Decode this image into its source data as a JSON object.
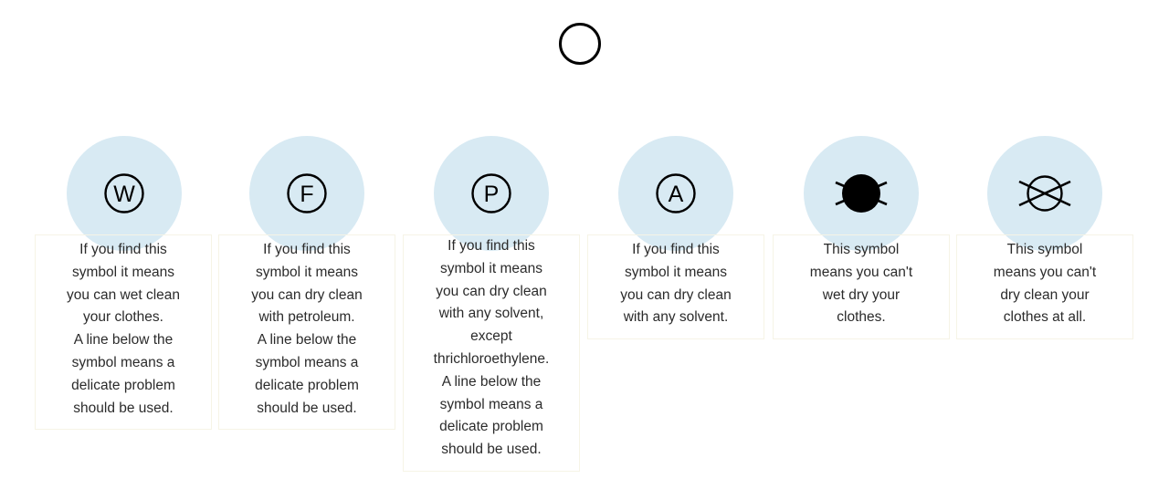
{
  "header_icon": "plain-circle-icon",
  "cards": [
    {
      "icon": "circle-w-icon",
      "letter": "W",
      "text": "If you find this\nsymbol it means\nyou can wet clean\nyour clothes.\nA line below the\nsymbol means a\ndelicate problem\nshould be used."
    },
    {
      "icon": "circle-f-icon",
      "letter": "F",
      "text": "If you find this\nsymbol it means\nyou can dry clean\nwith petroleum.\nA line below the\nsymbol means a\ndelicate problem\nshould be used."
    },
    {
      "icon": "circle-p-icon",
      "letter": "P",
      "text": "If you find this\nsymbol it means\nyou can dry clean\nwith any solvent,\nexcept\nthrichloroethylene.\nA line below the\nsymbol means a\ndelicate problem\nshould be used."
    },
    {
      "icon": "circle-a-icon",
      "letter": "A",
      "text": "If you find this\nsymbol it means\nyou can dry clean\nwith any solvent."
    },
    {
      "icon": "filled-circle-crossed-icon",
      "letter": "",
      "text": "This symbol\nmeans you can't\nwet dry your\nclothes."
    },
    {
      "icon": "circle-crossed-icon",
      "letter": "",
      "text": "This symbol\nmeans you can't\ndry clean your\nclothes at all."
    }
  ],
  "colors": {
    "badge": "#d8eaf3",
    "box_border": "#f6f4e6",
    "ink": "#000000"
  }
}
